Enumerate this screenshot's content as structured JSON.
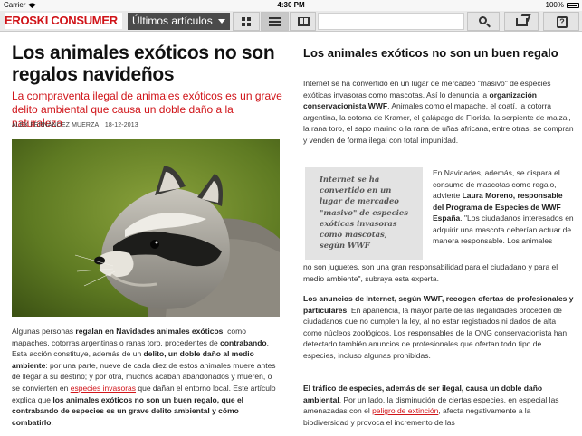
{
  "status_bar": {
    "carrier": "Carrier",
    "time": "4:30 PM",
    "battery": "100%"
  },
  "toolbar": {
    "logo": "EROSKI CONSUMER",
    "section_select": "Últimos artículos",
    "search_placeholder": ""
  },
  "left": {
    "title": "Los animales exóticos no son regalos navideños",
    "subtitle": "La compraventa ilegal de animales exóticos es un grave delito ambiental que causa un doble daño a la naturaleza",
    "author": "ALEX FERNÁNDEZ MUERZA",
    "date": "18-12-2013",
    "body": {
      "t1": "Algunas personas ",
      "b1": "regalan en Navidades animales exóticos",
      "t2": ", como mapaches, cotorras argentinas o ranas toro, procedentes de ",
      "b2": "contrabando",
      "t3": ". Esta acción constituye, además de un ",
      "b3": "delito, un doble daño al medio ambiente",
      "t4": ": por una parte, nueve de cada diez de estos animales muere antes de llegar a su destino; y por otra, muchos acaban abandonados y mueren, o se convierten en ",
      "link": "especies invasoras",
      "t5": " que dañan el entorno local. Este artículo explica que ",
      "b4": "los animales exóticos no son un buen regalo, que el contrabando de especies es un grave delito ambiental y cómo combatirlo",
      "t6": "."
    }
  },
  "right": {
    "title": "Los animales exóticos no son un buen regalo",
    "p1": {
      "t1": "Internet se ha convertido en un lugar de mercadeo \"masivo\" de especies exóticas invasoras como mascotas. Así lo denuncia la ",
      "b1": "organización conservacionista WWF",
      "t2": ". Animales como el mapache, el coatí, la cotorra argentina, la cotorra de Kramer, el galápago de Florida, la serpiente de maizal, la rana toro, el sapo marino o la rana de uñas africana, entre otras, se compran y venden de forma ilegal con total impunidad."
    },
    "pullquote": "Internet se ha convertido en un lugar de mercadeo \"masivo\" de especies exóticas invasoras como mascotas, según WWF",
    "p2": {
      "t1": "En Navidades, además, se dispara el consumo de mascotas como regalo, advierte ",
      "b1": "Laura Moreno, responsable del Programa de Especies de WWF España",
      "t2": ". \"Los ciudadanos interesados en adquirir una mascota deberían actuar de manera responsable. Los animales",
      "cont": "no son juguetes, son una gran responsabilidad para el ciudadano y para el medio ambiente\", subraya esta experta."
    },
    "p3": {
      "b1": "Los anuncios de Internet, según WWF, recogen ofertas de profesionales y particulares",
      "t1": ". En apariencia, la mayor parte de las ilegalidades proceden de ciudadanos que no cumplen la ley, al no estar registrados ni dados de alta como núcleos zoológicos. Los responsables de la ONG conservacionista han detectado también anuncios de profesionales que ofertan todo tipo de especies, incluso algunas prohibidas."
    },
    "p4": {
      "b1": "El tráfico de especies, además de ser ilegal, causa un doble daño ambiental",
      "t1": ". Por un lado, la disminución de ciertas especies, en especial las amenazadas con el ",
      "link": "peligro de extinción",
      "t2": ", afecta negativamente a la biodiversidad y provoca el incremento de las"
    }
  },
  "colors": {
    "brand_red": "#d01419",
    "toolbar_bg": "#e9e9e9",
    "select_bg": "#4b4b4b"
  },
  "icons": [
    "wifi-icon",
    "battery-icon",
    "grid-icon",
    "list-icon",
    "book-icon",
    "search-icon",
    "share-icon",
    "help-icon",
    "chevron-down-icon"
  ]
}
